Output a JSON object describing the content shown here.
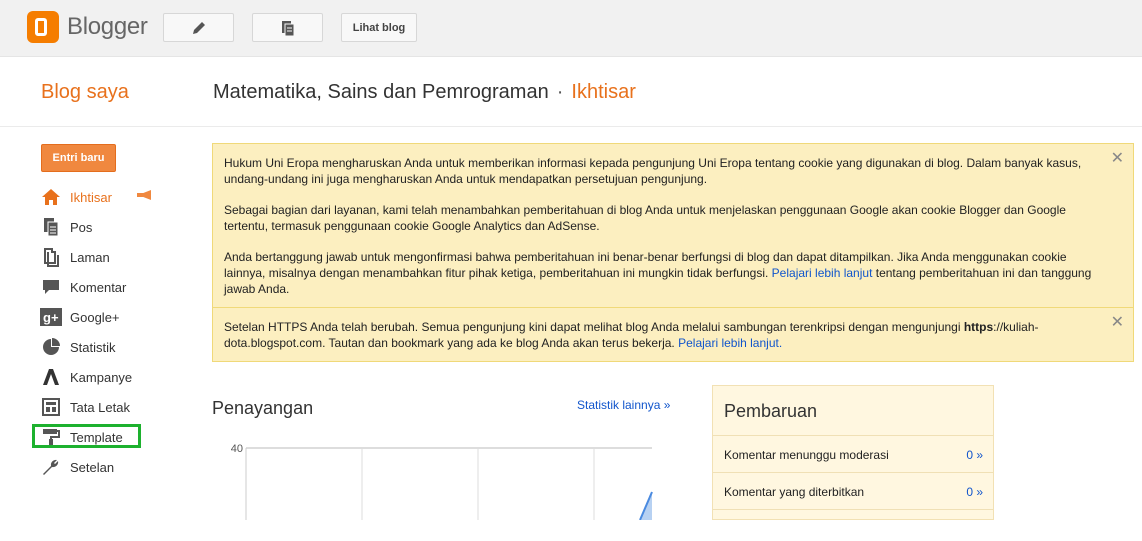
{
  "app": {
    "name": "Blogger"
  },
  "toolbar": {
    "view_blog_label": "Lihat blog"
  },
  "header": {
    "my_blogs": "Blog saya",
    "blog_title": "Matematika, Sains dan Pemrograman",
    "separator": "·",
    "section": "Ikhtisar"
  },
  "sidebar": {
    "new_post": "Entri baru",
    "items": [
      {
        "label": "Ikhtisar",
        "icon": "home-icon"
      },
      {
        "label": "Pos",
        "icon": "posts-icon"
      },
      {
        "label": "Laman",
        "icon": "pages-icon"
      },
      {
        "label": "Komentar",
        "icon": "comment-icon"
      },
      {
        "label": "Google+",
        "icon": "google-plus-icon"
      },
      {
        "label": "Statistik",
        "icon": "pie-chart-icon"
      },
      {
        "label": "Kampanye",
        "icon": "adwords-icon"
      },
      {
        "label": "Tata Letak",
        "icon": "layout-icon"
      },
      {
        "label": "Template",
        "icon": "paint-roller-icon"
      },
      {
        "label": "Setelan",
        "icon": "wrench-icon"
      }
    ]
  },
  "notice_cookie": {
    "p1": "Hukum Uni Eropa mengharuskan Anda untuk memberikan informasi kepada pengunjung Uni Eropa tentang cookie yang digunakan di blog. Dalam banyak kasus, undang-undang ini juga mengharuskan Anda untuk mendapatkan persetujuan pengunjung.",
    "p2": "Sebagai bagian dari layanan, kami telah menambahkan pemberitahuan di blog Anda untuk menjelaskan penggunaan Google akan cookie Blogger dan Google tertentu, termasuk penggunaan cookie Google Analytics dan AdSense.",
    "p3_a": "Anda bertanggung jawab untuk mengonfirmasi bahwa pemberitahuan ini benar-benar berfungsi di blog dan dapat ditampilkan. Jika Anda menggunakan cookie lainnya, misalnya dengan menambahkan fitur pihak ketiga, pemberitahuan ini mungkin tidak berfungsi.",
    "p3_link": "Pelajari lebih lanjut",
    "p3_b": "tentang pemberitahuan ini dan tanggung jawab Anda."
  },
  "notice_https": {
    "text_a": "Setelan HTTPS Anda telah berubah. Semua pengunjung kini dapat melihat blog Anda melalui sambungan terenkripsi dengan mengunjungi",
    "bold": "https",
    "text_b": "://kuliah-dota.blogspot.com. Tautan dan bookmark yang ada ke blog Anda akan terus bekerja.",
    "link": "Pelajari lebih lanjut."
  },
  "views": {
    "title": "Penayangan",
    "more_stats": "Statistik lainnya »"
  },
  "chart_data": {
    "type": "area",
    "ytick_labels": [
      "40"
    ],
    "ylim": [
      0,
      40
    ]
  },
  "updates": {
    "title": "Pembaruan",
    "rows": [
      {
        "label": "Komentar menunggu moderasi",
        "count": "0 »"
      },
      {
        "label": "Komentar yang diterbitkan",
        "count": "0 »"
      }
    ]
  },
  "colors": {
    "accent": "#e8711c",
    "notice_bg": "#fcefc0",
    "link": "#1155cc",
    "highlight": "#1db12e"
  }
}
